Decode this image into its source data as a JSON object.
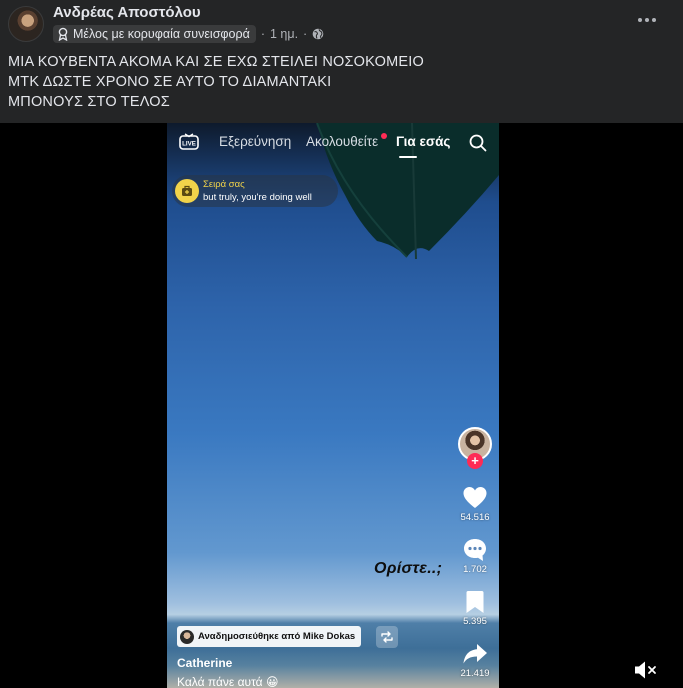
{
  "post": {
    "author": "Ανδρέας Αποστόλου",
    "badge": "Μέλος με κορυφαία συνεισφορά",
    "separator": "·",
    "time": "1 ημ.",
    "separator2": "·",
    "text_lines": [
      "ΜΙΑ ΚΟΥΒΕΝΤΑ ΑΚΟΜΑ ΚΑΙ ΣΕ ΕΧΩ ΣΤΕΙΛΕΙ ΝΟΣΟΚΟΜΕΙΟ",
      "ΜΤΚ ΔΩΣΤΕ ΧΡΟΝΟ ΣΕ ΑΥΤΟ ΤΟ ΔΙΑΜΑΝΤΑΚΙ",
      "ΜΠΟΝΟΥΣ ΣΤΟ ΤΕΛΟΣ"
    ]
  },
  "tiktok": {
    "nav": {
      "live": "LIVE",
      "tabs": [
        "Εξερεύνηση",
        "Ακολουθείτε",
        "Για εσάς"
      ],
      "active_tab": "Για εσάς"
    },
    "series": {
      "title": "Σειρά σας",
      "subtitle": "but truly, you're doing well"
    },
    "rail": {
      "likes": "54.516",
      "comments": "1.702",
      "saves": "5.395",
      "shares": "21.419"
    },
    "overlay_text": "Ορίστε..;",
    "repost_label": "Αναδημοσιεύθηκε από Mike Dokas",
    "creator": "Catherine",
    "caption": "Καλά πάνε αυτά 😀"
  },
  "colors": {
    "background": "#242526",
    "text": "#e4e6eb",
    "secondary": "#b0b3b8",
    "tiktok_red": "#fe2c55",
    "series_yellow": "#f1d34a"
  },
  "icons": [
    "badge-icon",
    "globe-icon",
    "more-icon",
    "live-icon",
    "search-icon",
    "heart-icon",
    "comment-icon",
    "bookmark-icon",
    "share-icon",
    "repost-icon",
    "volume-muted-icon"
  ]
}
